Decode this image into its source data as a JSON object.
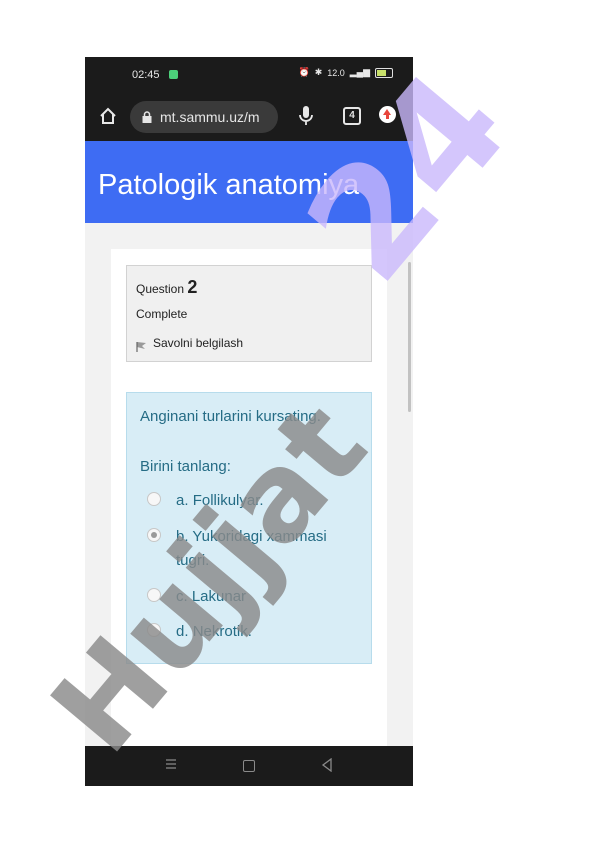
{
  "status_bar": {
    "time": "02:45",
    "network_speed": "12.0"
  },
  "browser": {
    "url": "mt.sammu.uz/m",
    "tab_count": "4"
  },
  "header": {
    "title": "Patologik anatomiya"
  },
  "question": {
    "label": "Question",
    "number": "2",
    "state": "Complete",
    "flag_label": "Savolni belgilash",
    "text": "Anginani turlarini kursating.",
    "prompt": "Birini tanlang:",
    "answers": [
      {
        "letter": "a.",
        "text": "Follikulyar.",
        "selected": false
      },
      {
        "letter": "b.",
        "text": "Yukoridagi xammasi tugri.",
        "selected": true
      },
      {
        "letter": "c.",
        "text": "Lakunar",
        "selected": false
      },
      {
        "letter": "d.",
        "text": "Nekrotik.",
        "selected": false
      }
    ]
  },
  "watermark": {
    "text": "Hujjat 24",
    "colors": [
      "#8a8a8a",
      "#c9b8fb"
    ]
  },
  "colors": {
    "header_blue": "#3e6cf3",
    "content_bg": "#d8edf6",
    "content_text": "#256c85"
  },
  "icons": [
    "home-icon",
    "lock-icon",
    "mic-icon",
    "tabs-icon",
    "update-icon",
    "flag-icon",
    "menu-icon",
    "home-square-icon",
    "back-icon"
  ]
}
